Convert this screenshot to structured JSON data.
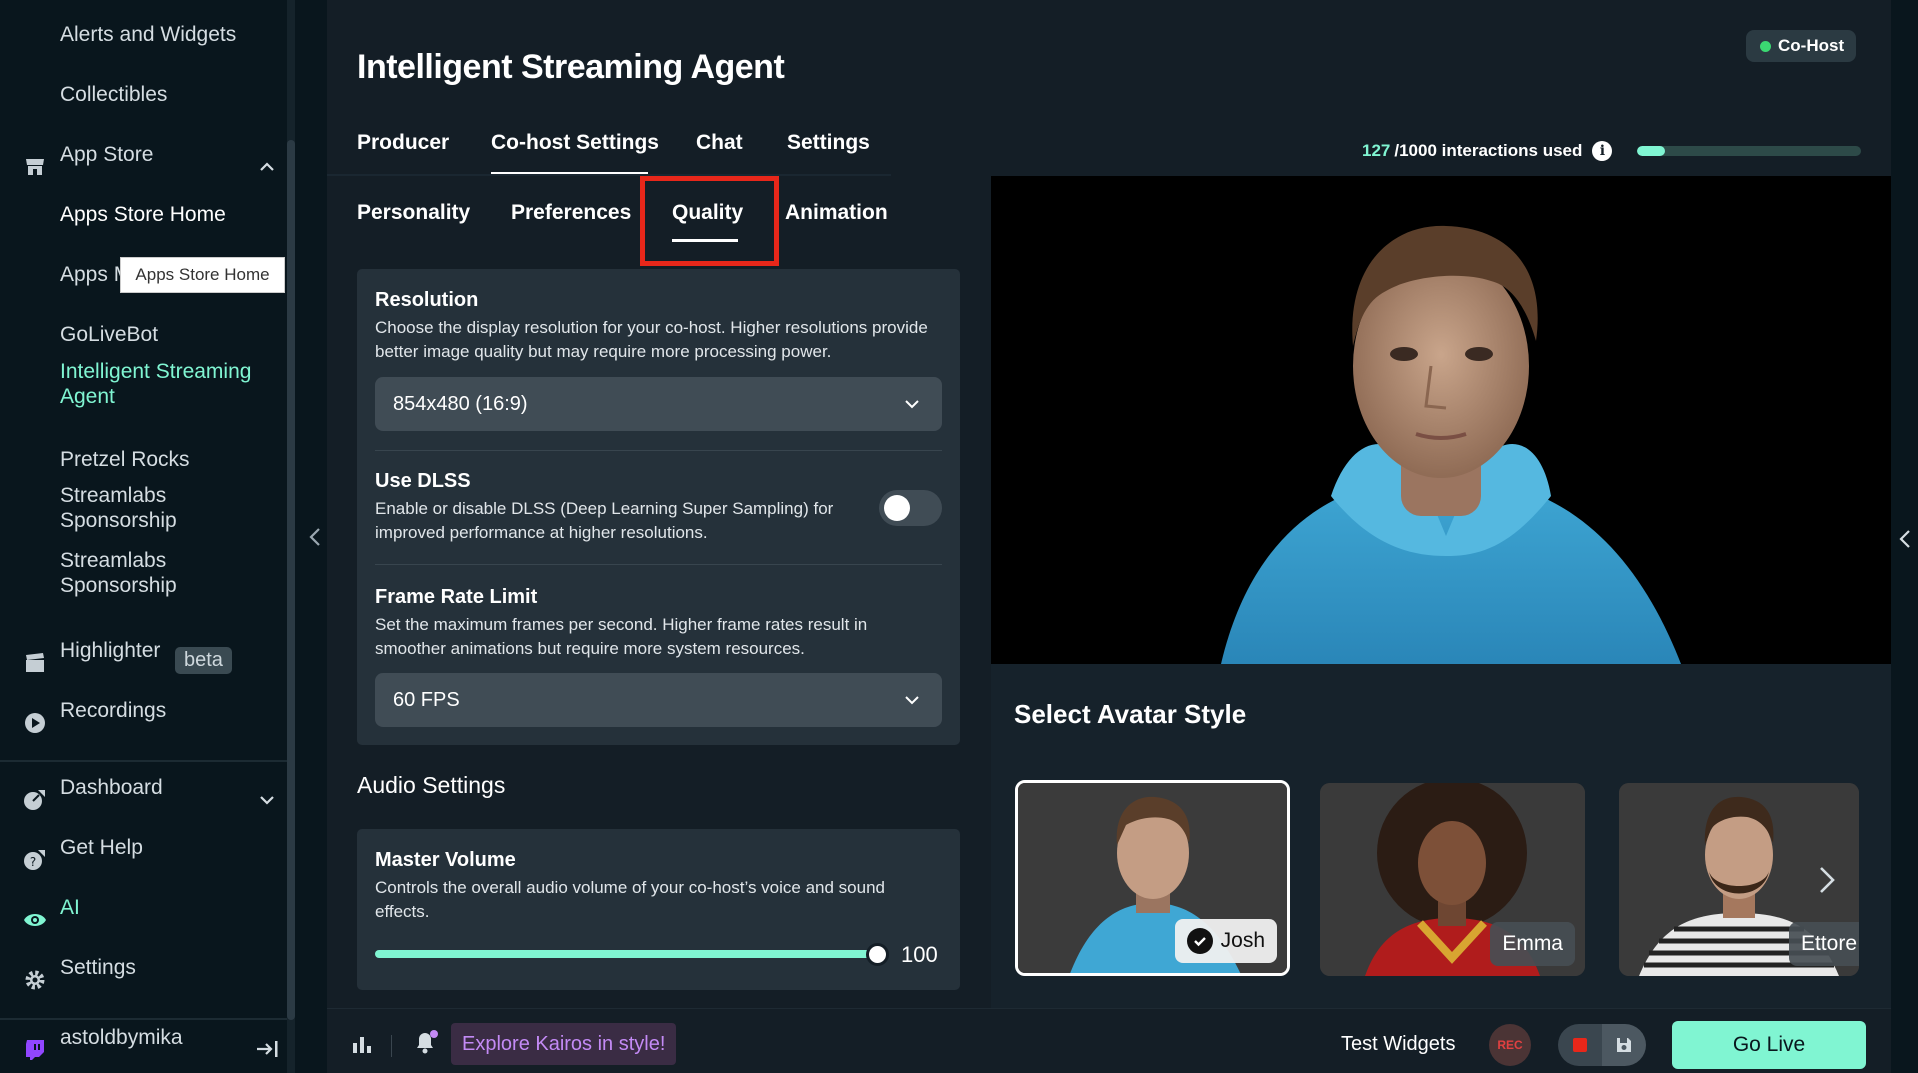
{
  "sidebar": {
    "items": [
      {
        "label": "Alerts and Widgets"
      },
      {
        "label": "Collectibles"
      },
      {
        "label": "App Store"
      },
      {
        "label": "Apps Store Home"
      },
      {
        "label": "Apps Manager"
      },
      {
        "label": "GoLiveBot"
      },
      {
        "label": "Intelligent Streaming Agent"
      },
      {
        "label": "Pretzel Rocks"
      },
      {
        "label": "Streamlabs Sponsorship"
      },
      {
        "label": "Streamlabs Sponsorship"
      },
      {
        "label": "Highlighter",
        "badge": "beta"
      },
      {
        "label": "Recordings"
      },
      {
        "label": "Dashboard"
      },
      {
        "label": "Get Help"
      },
      {
        "label": "AI"
      },
      {
        "label": "Settings"
      }
    ],
    "tooltip": "Apps Store Home",
    "user": "astoldbymika"
  },
  "header": {
    "title": "Intelligent Streaming Agent",
    "cohost_badge": "Co-Host",
    "tabs": [
      {
        "label": "Producer"
      },
      {
        "label": "Co-host Settings",
        "active": true
      },
      {
        "label": "Chat"
      },
      {
        "label": "Settings"
      }
    ],
    "usage": {
      "used": "127",
      "total_text": "/1000 interactions used",
      "fraction": 0.127
    }
  },
  "subtabs": [
    {
      "label": "Personality"
    },
    {
      "label": "Preferences"
    },
    {
      "label": "Quality",
      "active": true
    },
    {
      "label": "Animation"
    }
  ],
  "quality": {
    "resolution": {
      "title": "Resolution",
      "desc": "Choose the display resolution for your co-host. Higher resolutions provide better image quality but may require more processing power.",
      "value": "854x480 (16:9)"
    },
    "dlss": {
      "title": "Use DLSS",
      "desc": "Enable or disable DLSS (Deep Learning Super Sampling) for improved performance at higher resolutions.",
      "enabled": false
    },
    "framerate": {
      "title": "Frame Rate Limit",
      "desc": "Set the maximum frames per second. Higher frame rates result in smoother animations but require more system resources.",
      "value": "60 FPS"
    }
  },
  "audio": {
    "section_title": "Audio Settings",
    "master": {
      "title": "Master Volume",
      "desc": "Controls the overall audio volume of your co-host’s voice and sound effects.",
      "value": "100"
    }
  },
  "avatars": {
    "title": "Select Avatar Style",
    "items": [
      {
        "name": "Josh",
        "selected": true
      },
      {
        "name": "Emma"
      },
      {
        "name": "Ettore"
      }
    ]
  },
  "footer": {
    "promo": "Explore Kairos in style!",
    "test_widgets": "Test Widgets",
    "rec": "REC",
    "go_live": "Go Live"
  },
  "colors": {
    "accent": "#80f5d2",
    "highlight": "#e8271a",
    "promo_text": "#c38af5"
  }
}
